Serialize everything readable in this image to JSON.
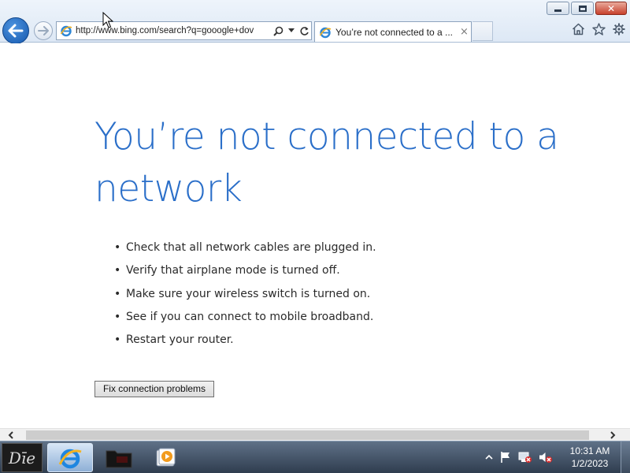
{
  "browser": {
    "address_url": "http://www.bing.com/search?q=gooogle+dov",
    "tab_title": "You’re not connected to a ...",
    "tab_close": "×"
  },
  "page": {
    "heading": "You’re not connected to a network",
    "bullet_char": "•",
    "tips": [
      "Check that all network cables are plugged in.",
      "Verify that airplane mode is turned off.",
      "Make sure your wireless switch is turned on.",
      "See if you can connect to mobile broadband.",
      "Restart your router."
    ],
    "fix_button_label": "Fix connection problems"
  },
  "taskbar": {
    "start_label": "Dīe",
    "clock_time": "10:31 AM",
    "clock_date": "1/2/2023"
  },
  "colors": {
    "heading": "#2b6fc9",
    "back_button": "#1658ad",
    "taskbar": "#3d4d60"
  },
  "icons": [
    "back-arrow-icon",
    "forward-arrow-icon",
    "ie-icon",
    "search-icon",
    "dropdown-icon",
    "refresh-icon",
    "home-icon",
    "favorites-star-icon",
    "settings-gear-icon",
    "minimize-icon",
    "restore-icon",
    "close-icon",
    "scroll-left-icon",
    "scroll-right-icon",
    "folder-icon",
    "media-player-icon",
    "tray-up-icon",
    "flag-icon",
    "network-icon",
    "volume-muted-icon"
  ]
}
